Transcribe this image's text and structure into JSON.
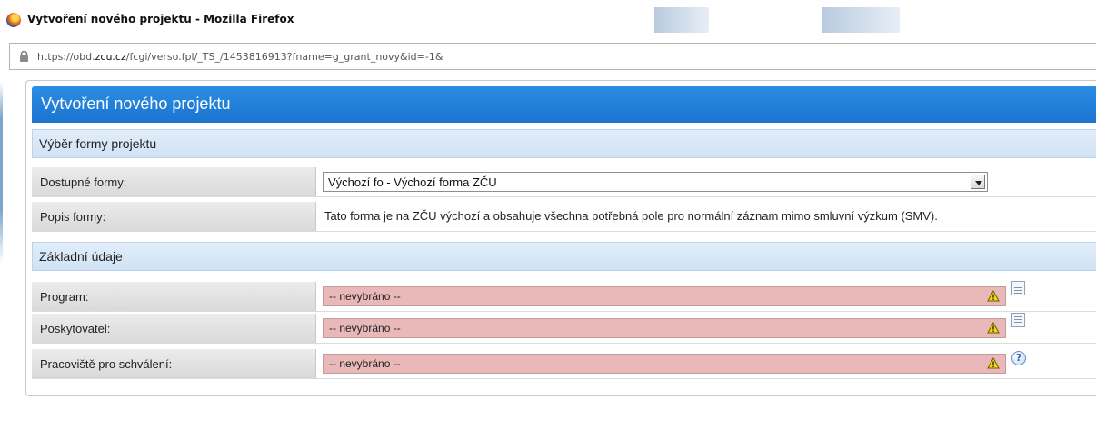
{
  "window": {
    "title": "Vytvoření nového projektu - Mozilla Firefox",
    "url_prefix": "https://obd.",
    "url_domain": "zcu.cz",
    "url_path": "/fcgi/verso.fpl/_TS_/1453816913?fname=g_grant_novy&id=-1&"
  },
  "page": {
    "title": "Vytvoření nového projektu",
    "section_form": "Výběr formy projektu",
    "section_basic": "Základní údaje"
  },
  "form_choice": {
    "available_label": "Dostupné formy:",
    "available_value": "Výchozí fo - Výchozí forma ZČU",
    "description_label": "Popis formy:",
    "description_value": "Tato forma je na ZČU výchozí a obsahuje všechna potřebná pole pro normální záznam mimo smluvní výzkum (SMV)."
  },
  "basic": {
    "program_label": "Program:",
    "program_value": "-- nevybráno --",
    "provider_label": "Poskytovatel:",
    "provider_value": "-- nevybráno --",
    "workplace_label": "Pracoviště pro schválení:",
    "workplace_value": "-- nevybráno --"
  },
  "icons": {
    "warning": "warning-icon",
    "list": "list-icon",
    "help": "help-icon",
    "help_glyph": "?"
  },
  "colors": {
    "header_blue": "#1a74d0",
    "required_field_bg": "#e9b8b8"
  }
}
